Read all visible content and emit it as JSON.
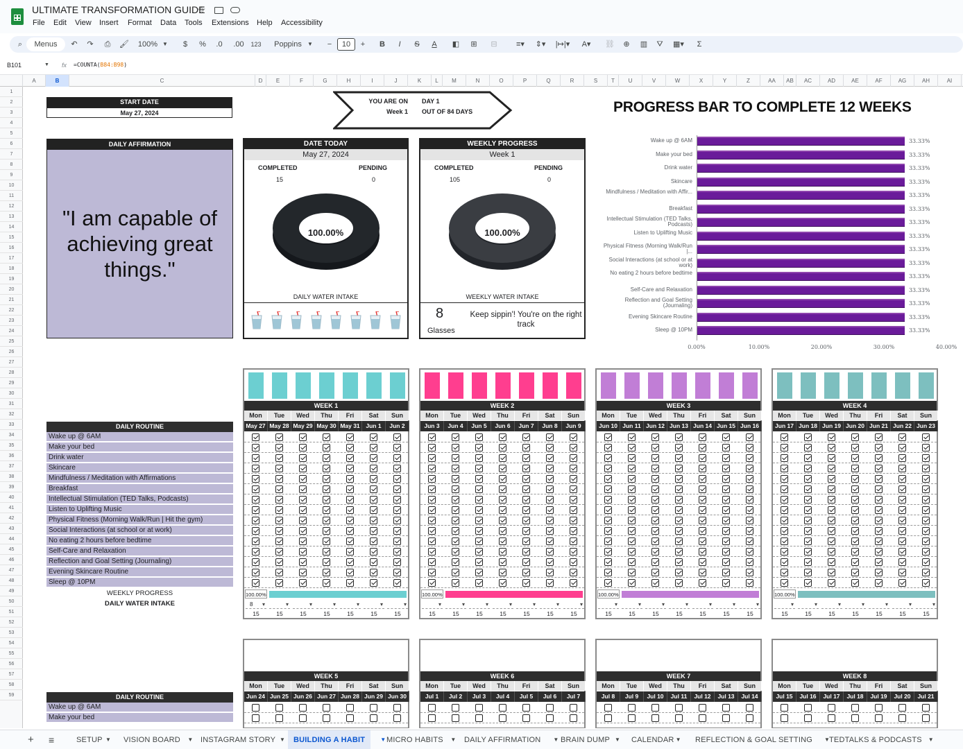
{
  "doc": {
    "title": "ULTIMATE TRANSFORMATION GUIDE",
    "menu": [
      "File",
      "Edit",
      "View",
      "Insert",
      "Format",
      "Data",
      "Tools",
      "Extensions",
      "Help",
      "Accessibility"
    ]
  },
  "toolbar": {
    "menus": "Menus",
    "zoom": "100%",
    "currency": "$",
    "percent": "%",
    "dec_less": ".0",
    "dec_more": ".00",
    "num_format": "123",
    "font": "Poppins",
    "font_size": "10",
    "bold": "B",
    "italic": "I",
    "strike": "S",
    "text_color": "A"
  },
  "formula": {
    "cell_ref": "B101",
    "fx": "fx",
    "formula_prefix": "=COUNTA(",
    "formula_range": "B84:B98",
    "formula_suffix": ")"
  },
  "columns": [
    "A",
    "B",
    "C",
    "D",
    "E",
    "F",
    "G",
    "H",
    "I",
    "J",
    "K",
    "L",
    "M",
    "N",
    "O",
    "P",
    "Q",
    "R",
    "S",
    "T",
    "U",
    "V",
    "W",
    "X",
    "Y",
    "Z",
    "AA",
    "AB",
    "AC",
    "AD",
    "AE",
    "AF",
    "AG",
    "AH",
    "AI"
  ],
  "rows": [
    "1",
    "2",
    "3",
    "4",
    "5",
    "6",
    "7",
    "8",
    "9",
    "10",
    "11",
    "12",
    "13",
    "14",
    "15",
    "16",
    "17",
    "18",
    "19",
    "20",
    "21",
    "22",
    "23",
    "24",
    "25",
    "26",
    "27",
    "28",
    "29",
    "30",
    "31",
    "32",
    "33",
    "34",
    "35",
    "36",
    "37",
    "38",
    "39",
    "40",
    "41",
    "42",
    "43",
    "44",
    "45",
    "46",
    "47",
    "48",
    "49",
    "50",
    "51",
    "52",
    "53",
    "54",
    "55",
    "56",
    "57",
    "58",
    "59"
  ],
  "start": {
    "label": "START DATE",
    "value": "May 27, 2024"
  },
  "arrow": {
    "l1": "YOU ARE ON",
    "l2": "Week 1",
    "r1": "DAY 1",
    "r2": "OUT OF 84 DAYS"
  },
  "affirmation": {
    "label": "DAILY AFFIRMATION",
    "text": "\"I am capable of achieving great things.\""
  },
  "today": {
    "label": "DATE TODAY",
    "date": "May 27, 2024",
    "completed_label": "COMPLETED",
    "pending_label": "PENDING",
    "completed": "15",
    "pending": "0",
    "percent": "100.00%",
    "completed_fraction": 1.0,
    "water_label": "DAILY WATER INTAKE"
  },
  "weekly": {
    "label": "WEEKLY PROGRESS",
    "week": "Week 1",
    "completed_label": "COMPLETED",
    "pending_label": "PENDING",
    "completed": "105",
    "pending": "0",
    "percent": "100.00%",
    "completed_fraction": 1.0,
    "water_label": "WEEKLY WATER INTAKE",
    "glasses": "8",
    "glasses_label": "Glasses",
    "message": "Keep sippin'! You're on the right track"
  },
  "chart_data": {
    "type": "bar",
    "title": "PROGRESS BAR TO COMPLETE 12 WEEKS",
    "categories": [
      "Wake up @ 6AM",
      "Make your bed",
      "Drink water",
      "Skincare",
      "Mindfulness / Meditation with Affir...",
      "Breakfast",
      "Intellectual Stimulation (TED Talks, Podcasts)",
      "Listen to Uplifting Music",
      "Physical Fitness (Morning Walk/Run |...",
      "Social Interactions (at school or at work)",
      "No eating 2 hours before bedtime",
      "Self-Care and Relaxation",
      "Reflection and Goal Setting (Journaling)",
      "Evening Skincare Routine",
      "Sleep @ 10PM"
    ],
    "values": [
      33.33,
      33.33,
      33.33,
      33.33,
      33.33,
      33.33,
      33.33,
      33.33,
      33.33,
      33.33,
      33.33,
      33.33,
      33.33,
      33.33,
      33.33
    ],
    "value_labels": [
      "33.33%",
      "33.33%",
      "33.33%",
      "33.33%",
      "33.33%",
      "33.33%",
      "33.33%",
      "33.33%",
      "33.33%",
      "33.33%",
      "33.33%",
      "33.33%",
      "33.33%",
      "33.33%",
      "33.33%"
    ],
    "xlim": [
      0,
      40
    ],
    "xticks": [
      "0.00%",
      "10.00%",
      "20.00%",
      "30.00%",
      "40.00%"
    ],
    "bar_color": "#6a1b9a"
  },
  "routine": {
    "label": "DAILY ROUTINE",
    "items": [
      "Wake up @ 6AM",
      "Make your bed",
      "Drink water",
      "Skincare",
      "Mindfulness / Meditation with Affirmations",
      "Breakfast",
      "Intellectual Stimulation (TED Talks, Podcasts)",
      "Listen to Uplifting Music",
      "Physical Fitness (Morning Walk/Run | Hit the gym)",
      "Social Interactions (at school or at work)",
      "No eating 2 hours before bedtime",
      "Self-Care and Relaxation",
      "Reflection and Goal Setting (Journaling)",
      "Evening Skincare Routine",
      "Sleep @ 10PM"
    ],
    "weekly_progress_label": "WEEKLY PROGRESS",
    "water_label": "DAILY WATER INTAKE"
  },
  "days": [
    "Mon",
    "Tue",
    "Wed",
    "Thu",
    "Fri",
    "Sat",
    "Sun"
  ],
  "weeks": [
    {
      "label": "WEEK 1",
      "color": "#6ccfd1",
      "dates": [
        "May 27",
        "May 28",
        "May 29",
        "May 30",
        "May 31",
        "Jun 1",
        "Jun 2"
      ],
      "progress": "100.00%",
      "progress_fraction": 1.0,
      "water": "8",
      "counts": [
        "15",
        "15",
        "15",
        "15",
        "15",
        "15",
        "15"
      ]
    },
    {
      "label": "WEEK 2",
      "color": "#ff3e8f",
      "dates": [
        "Jun 3",
        "Jun 4",
        "Jun 5",
        "Jun 6",
        "Jun 7",
        "Jun 8",
        "Jun 9"
      ],
      "progress": "100.00%",
      "progress_fraction": 1.0,
      "water": "",
      "counts": [
        "15",
        "15",
        "15",
        "15",
        "15",
        "15",
        "15"
      ]
    },
    {
      "label": "WEEK 3",
      "color": "#c17ed6",
      "dates": [
        "Jun 10",
        "Jun 11",
        "Jun 12",
        "Jun 13",
        "Jun 14",
        "Jun 15",
        "Jun 16"
      ],
      "progress": "100.00%",
      "progress_fraction": 1.0,
      "water": "",
      "counts": [
        "15",
        "15",
        "15",
        "15",
        "15",
        "15",
        "15"
      ]
    },
    {
      "label": "WEEK 4",
      "color": "#7dbfbf",
      "dates": [
        "Jun 17",
        "Jun 18",
        "Jun 19",
        "Jun 20",
        "Jun 21",
        "Jun 22",
        "Jun 23"
      ],
      "progress": "100.00%",
      "progress_fraction": 1.0,
      "water": "",
      "counts": [
        "15",
        "15",
        "15",
        "15",
        "15",
        "15",
        "15"
      ]
    },
    {
      "label": "WEEK 5",
      "dates": [
        "Jun 24",
        "Jun 25",
        "Jun 26",
        "Jun 27",
        "Jun 28",
        "Jun 29",
        "Jun 30"
      ]
    },
    {
      "label": "WEEK 6",
      "dates": [
        "Jul 1",
        "Jul 2",
        "Jul 3",
        "Jul 4",
        "Jul 5",
        "Jul 6",
        "Jul 7"
      ]
    },
    {
      "label": "WEEK 7",
      "dates": [
        "Jul 8",
        "Jul 9",
        "Jul 10",
        "Jul 11",
        "Jul 12",
        "Jul 13",
        "Jul 14"
      ]
    },
    {
      "label": "WEEK 8",
      "dates": [
        "Jul 15",
        "Jul 16",
        "Jul 17",
        "Jul 18",
        "Jul 19",
        "Jul 20",
        "Jul 21"
      ]
    }
  ],
  "tabs": [
    "SETUP",
    "VISION BOARD",
    "INSTAGRAM STORY",
    "BUILDING A HABIT",
    "MICRO HABITS",
    "DAILY AFFIRMATION",
    "BRAIN DUMP",
    "CALENDAR",
    "REFLECTION & GOAL SETTING",
    "TEDTALKS & PODCASTS"
  ],
  "active_tab": "BUILDING A HABIT",
  "icons": {
    "sheets": "sheets-logo-icon",
    "star": "star-icon",
    "folder": "move-folder-icon",
    "cloud": "cloud-status-icon",
    "search": "search-icon"
  }
}
